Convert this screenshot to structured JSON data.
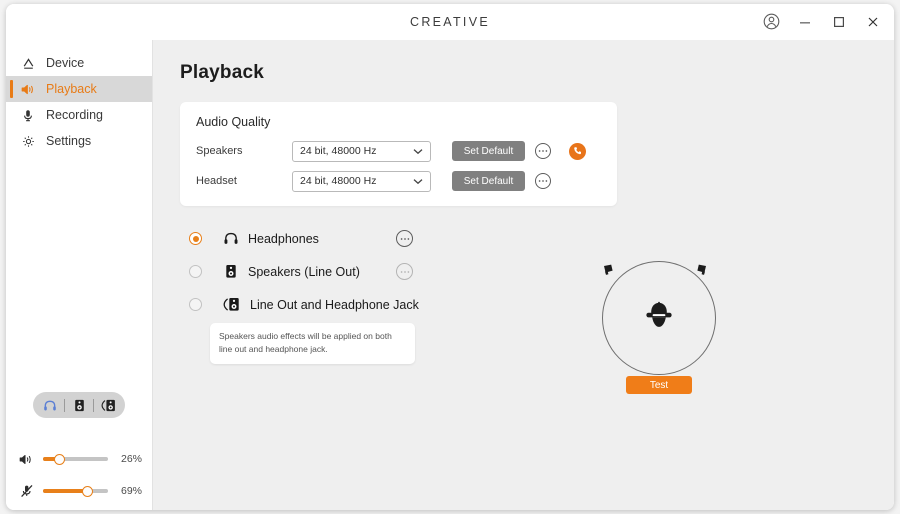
{
  "titlebar": {
    "brand": "CREATIVE",
    "account_icon": "account-circle-icon",
    "minimize_icon": "minimize-icon",
    "maximize_icon": "maximize-icon",
    "close_icon": "close-icon"
  },
  "sidebar": {
    "items": [
      {
        "label": "Device",
        "icon": "device-icon",
        "active": false
      },
      {
        "label": "Playback",
        "icon": "speaker-wave-icon",
        "active": true
      },
      {
        "label": "Recording",
        "icon": "microphone-icon",
        "active": false
      },
      {
        "label": "Settings",
        "icon": "gear-icon",
        "active": false
      }
    ],
    "device_switch": [
      {
        "icon": "headphones-icon",
        "selected": true
      },
      {
        "icon": "speaker-icon",
        "selected": false
      },
      {
        "icon": "line-out-and-headphone-jack-icon",
        "selected": false
      }
    ],
    "sliders": [
      {
        "name": "volume",
        "icon": "volume-icon",
        "value": 26,
        "value_label": "26%"
      },
      {
        "name": "microphone",
        "icon": "microphone-muted-icon",
        "value": 69,
        "value_label": "69%"
      }
    ]
  },
  "main": {
    "page_title": "Playback",
    "audio_quality": {
      "title": "Audio Quality",
      "rows": [
        {
          "label": "Speakers",
          "format": "24 bit, 48000 Hz",
          "set_default_label": "Set Default",
          "more_icon": "more-options-icon",
          "call_badge_icon": "phone-icon"
        },
        {
          "label": "Headset",
          "format": "24 bit, 48000 Hz",
          "set_default_label": "Set Default",
          "more_icon": "more-options-icon"
        }
      ]
    },
    "outputs": {
      "options": [
        {
          "label": "Headphones",
          "icon": "headphones-icon",
          "selected": true,
          "has_more": true
        },
        {
          "label": "Speakers (Line Out)",
          "icon": "speaker-icon",
          "selected": false,
          "has_more": true
        },
        {
          "label": "Line Out and Headphone Jack",
          "icon": "line-out-and-headphone-jack-icon",
          "selected": false,
          "has_more": false
        }
      ],
      "tooltip": "Speakers audio effects will be applied on both line out and headphone jack."
    },
    "stage": {
      "test_label": "Test",
      "head_icon": "head-with-headphones-icon",
      "left_speaker_icon": "speaker-cone-icon",
      "right_speaker_icon": "speaker-cone-icon"
    }
  },
  "colors": {
    "accent": "#e8801a",
    "test_button": "#f07d18",
    "active_nav_bg": "#d8d8d8",
    "main_bg": "#efefef",
    "device_switch_selected": "#5b7fd4"
  }
}
